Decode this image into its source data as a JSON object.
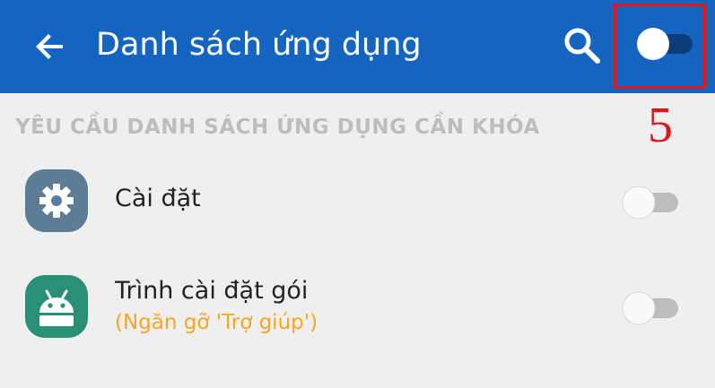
{
  "header": {
    "title": "Danh sách ứng dụng",
    "back_icon": "arrow-back-icon",
    "search_icon": "search-icon",
    "master_toggle_state": "off"
  },
  "annotation": {
    "label": "5",
    "color": "#e0161d"
  },
  "section": {
    "title": "YÊU CẦU DANH SÁCH ỨNG DỤNG CẦN KHÓA"
  },
  "apps": [
    {
      "name": "Cài đặt",
      "subtitle": "",
      "icon": "settings-gear-icon",
      "toggle_state": "off"
    },
    {
      "name": "Trình cài đặt gói",
      "subtitle": "(Ngăn gỡ 'Trợ giúp')",
      "icon": "android-icon",
      "toggle_state": "off"
    }
  ],
  "colors": {
    "appbar": "#1565c0",
    "subtitle": "#f5a623",
    "settings_icon_bg": "#5c7c98",
    "android_icon_bg": "#2a9075"
  }
}
